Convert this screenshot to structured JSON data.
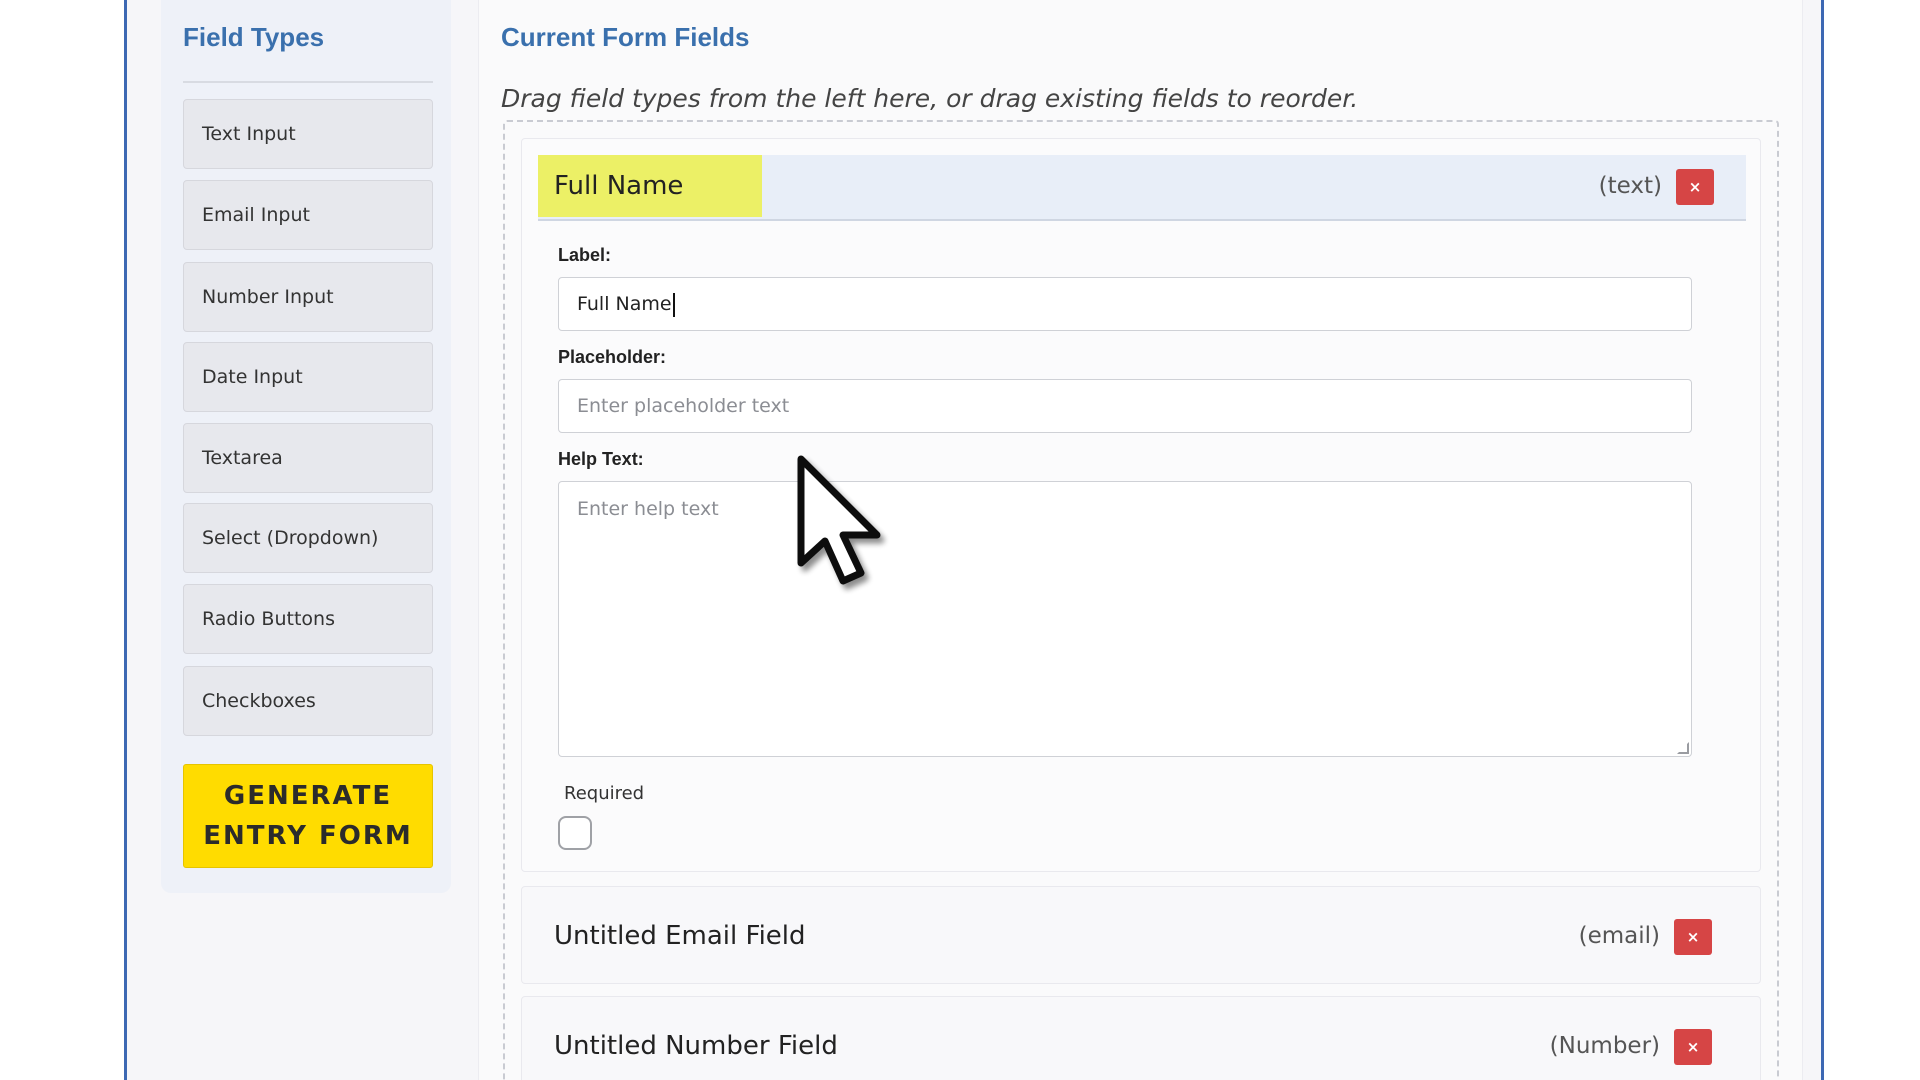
{
  "sidebar": {
    "title": "Field Types",
    "items": [
      {
        "label": "Text Input"
      },
      {
        "label": "Email Input"
      },
      {
        "label": "Number Input"
      },
      {
        "label": "Date Input"
      },
      {
        "label": "Textarea"
      },
      {
        "label": "Select (Dropdown)"
      },
      {
        "label": "Radio Buttons"
      },
      {
        "label": "Checkboxes"
      }
    ],
    "generate_label": "GENERATE ENTRY FORM"
  },
  "main": {
    "title": "Current Form Fields",
    "hint": "Drag field types from the left here, or drag existing fields to reorder.",
    "fields": [
      {
        "name": "Full Name",
        "type": "(text)",
        "remove_label": "×",
        "label_caption": "Label:",
        "label_value": "Full Name",
        "placeholder_caption": "Placeholder:",
        "placeholder_placeholder": "Enter placeholder text",
        "help_caption": "Help Text:",
        "help_placeholder": "Enter help text",
        "required_caption": "Required",
        "required_checked": false
      },
      {
        "name": "Untitled Email Field",
        "type": "(email)",
        "remove_label": "×"
      },
      {
        "name": "Untitled Number Field",
        "type": "(Number)",
        "remove_label": "×"
      }
    ]
  },
  "colors": {
    "accent_title": "#3a70ad",
    "highlight": "#ecf066",
    "generate_button": "#ffdc00",
    "remove_button": "#d64545",
    "frame_border": "#3d68b3"
  },
  "icons": {
    "cursor": "mouse-pointer-icon",
    "remove": "close-icon"
  }
}
